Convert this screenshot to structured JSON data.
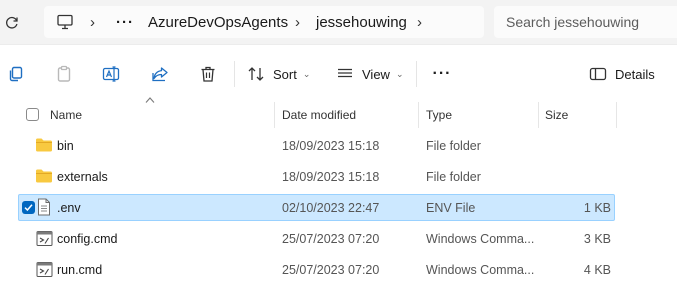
{
  "address_bar": {
    "crumbs": [
      "AzureDevOpsAgents",
      "jessehouwing"
    ],
    "overflow": "···",
    "separator": "›",
    "search_placeholder": "Search jessehouwing"
  },
  "toolbar": {
    "sort_label": "Sort",
    "view_label": "View",
    "more_label": "···",
    "details_label": "Details"
  },
  "columns": {
    "name": "Name",
    "date": "Date modified",
    "type": "Type",
    "size": "Size"
  },
  "files": [
    {
      "name": "bin",
      "date": "18/09/2023 15:18",
      "type": "File folder",
      "size": "",
      "icon": "folder-icon",
      "selected": false
    },
    {
      "name": "externals",
      "date": "18/09/2023 15:18",
      "type": "File folder",
      "size": "",
      "icon": "folder-icon",
      "selected": false
    },
    {
      "name": ".env",
      "date": "02/10/2023 22:47",
      "type": "ENV File",
      "size": "1 KB",
      "icon": "document-icon",
      "selected": true
    },
    {
      "name": "config.cmd",
      "date": "25/07/2023 07:20",
      "type": "Windows Comma...",
      "size": "3 KB",
      "icon": "cmd-script-icon",
      "selected": false
    },
    {
      "name": "run.cmd",
      "date": "25/07/2023 07:20",
      "type": "Windows Comma...",
      "size": "4 KB",
      "icon": "cmd-script-icon",
      "selected": false
    }
  ],
  "colors": {
    "accent": "#0067c0",
    "selection": "#cce8ff",
    "selection_border": "#99d1ff",
    "folder": "#f8c940",
    "toolbar_icon": "#1f6fc2"
  }
}
